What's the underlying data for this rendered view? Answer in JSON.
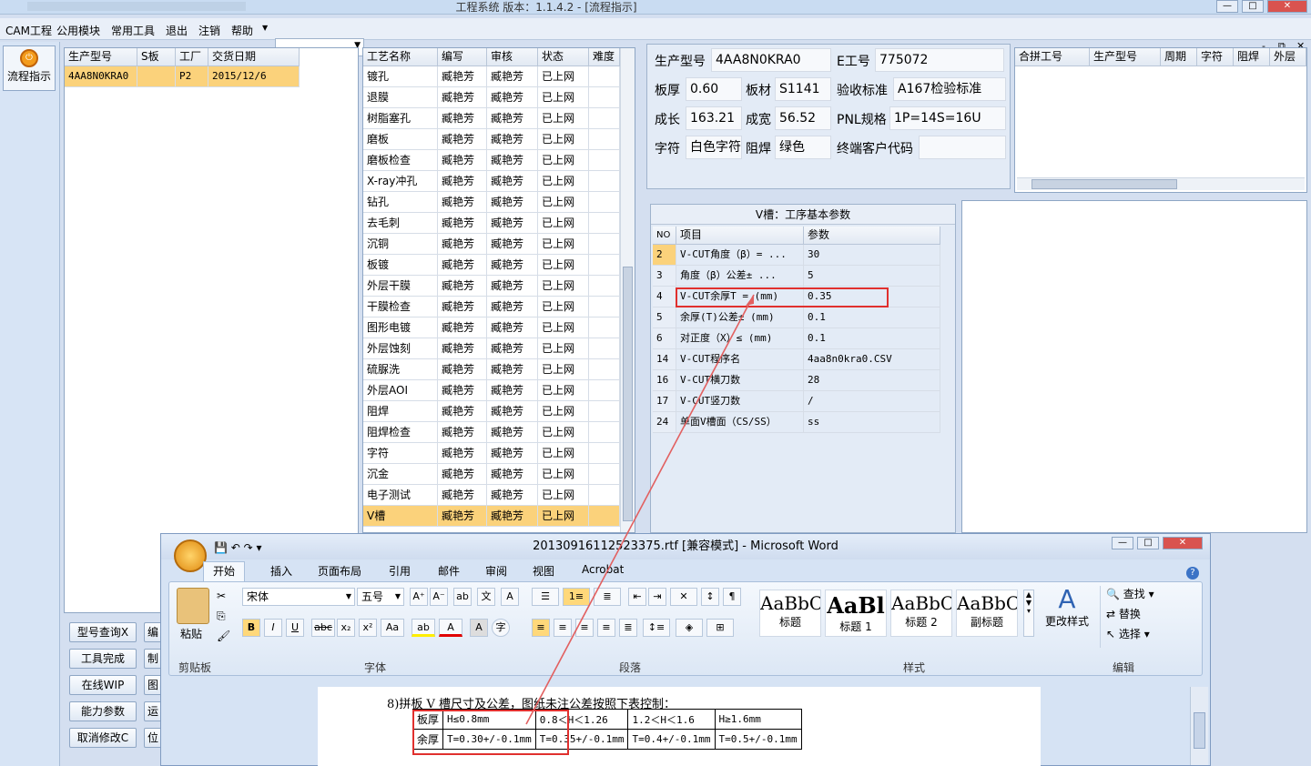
{
  "app": {
    "title": "工程系统   版本：1.1.4.2 - [流程指示]",
    "win_min": "—",
    "win_max": "□",
    "win_close": "✕"
  },
  "menu": [
    "CAM工程",
    "公用模块",
    "常用工具",
    "退出",
    "注销",
    "帮助"
  ],
  "mdi_controls": [
    "-",
    "⧉",
    "✕"
  ],
  "left_nav": {
    "flow_button": "流程指示"
  },
  "order_grid": {
    "headers": [
      "生产型号",
      "S板",
      "工厂",
      "交货日期"
    ],
    "rows": [
      [
        "4AA8N0KRA0",
        "",
        "P2",
        "2015/12/6"
      ]
    ]
  },
  "bottom_buttons": [
    "型号查询X",
    "工具完成",
    "在线WIP",
    "能力参数",
    "取消修改C"
  ],
  "bottom_buttons_right": [
    "编",
    "制",
    "图",
    "运",
    "位"
  ],
  "process_grid": {
    "headers": [
      "工艺名称",
      "编写",
      "审核",
      "状态",
      "难度"
    ],
    "rows": [
      [
        "镀孔",
        "臧艳芳",
        "臧艳芳",
        "已上网"
      ],
      [
        "退膜",
        "臧艳芳",
        "臧艳芳",
        "已上网"
      ],
      [
        "树脂塞孔",
        "臧艳芳",
        "臧艳芳",
        "已上网"
      ],
      [
        "磨板",
        "臧艳芳",
        "臧艳芳",
        "已上网"
      ],
      [
        "磨板检查",
        "臧艳芳",
        "臧艳芳",
        "已上网"
      ],
      [
        "X-ray冲孔",
        "臧艳芳",
        "臧艳芳",
        "已上网"
      ],
      [
        "钻孔",
        "臧艳芳",
        "臧艳芳",
        "已上网"
      ],
      [
        "去毛刺",
        "臧艳芳",
        "臧艳芳",
        "已上网"
      ],
      [
        "沉铜",
        "臧艳芳",
        "臧艳芳",
        "已上网"
      ],
      [
        "板镀",
        "臧艳芳",
        "臧艳芳",
        "已上网"
      ],
      [
        "外层干膜",
        "臧艳芳",
        "臧艳芳",
        "已上网"
      ],
      [
        "干膜检查",
        "臧艳芳",
        "臧艳芳",
        "已上网"
      ],
      [
        "图形电镀",
        "臧艳芳",
        "臧艳芳",
        "已上网"
      ],
      [
        "外层蚀刻",
        "臧艳芳",
        "臧艳芳",
        "已上网"
      ],
      [
        "硫脲洗",
        "臧艳芳",
        "臧艳芳",
        "已上网"
      ],
      [
        "外层AOI",
        "臧艳芳",
        "臧艳芳",
        "已上网"
      ],
      [
        "阻焊",
        "臧艳芳",
        "臧艳芳",
        "已上网"
      ],
      [
        "阻焊检查",
        "臧艳芳",
        "臧艳芳",
        "已上网"
      ],
      [
        "字符",
        "臧艳芳",
        "臧艳芳",
        "已上网"
      ],
      [
        "沉金",
        "臧艳芳",
        "臧艳芳",
        "已上网"
      ],
      [
        "电子测试",
        "臧艳芳",
        "臧艳芳",
        "已上网"
      ],
      [
        "V槽",
        "臧艳芳",
        "臧艳芳",
        "已上网"
      ]
    ]
  },
  "product_info": {
    "fields": [
      {
        "label": "生产型号",
        "value": "4AA8N0KRA0"
      },
      {
        "label": "E工号",
        "value": "775072"
      },
      {
        "label": "板厚",
        "value": "0.60"
      },
      {
        "label": "板材",
        "value": "S1141"
      },
      {
        "label": "验收标准",
        "value": "A167检验标准"
      },
      {
        "label": "成长",
        "value": "163.21"
      },
      {
        "label": "成宽",
        "value": "56.52"
      },
      {
        "label": "PNL规格",
        "value": "1P=14S=16U"
      },
      {
        "label": "字符",
        "value": "白色字符"
      },
      {
        "label": "阻焊",
        "value": "绿色"
      },
      {
        "label": "终端客户代码",
        "value": ""
      }
    ]
  },
  "merge_grid": {
    "headers": [
      "合拼工号",
      "生产型号",
      "周期",
      "字符",
      "阻焊",
      "外层"
    ]
  },
  "vcut": {
    "caption": "V槽：工序基本参数",
    "headers": [
      "NO",
      "项目",
      "参数"
    ],
    "rows": [
      [
        "2",
        "V-CUT角度（β）=  ...",
        "30"
      ],
      [
        "3",
        "角度（β）公差±  ...",
        "5"
      ],
      [
        "4",
        "V-CUT余厚T =  (mm)",
        "0.35"
      ],
      [
        "5",
        "余厚(T)公差±  (mm)",
        "0.1"
      ],
      [
        "6",
        "对正度（X）≤ (mm)",
        "0.1"
      ],
      [
        "14",
        "V-CUT程序名",
        "4aa8n0kra0.CSV"
      ],
      [
        "16",
        "V-CUT横刀数",
        "28"
      ],
      [
        "17",
        "V-CUT竖刀数",
        "/"
      ],
      [
        "24",
        "单面V槽面（CS/SS）",
        "ss"
      ]
    ]
  },
  "word": {
    "title": "20130916112523375.rtf [兼容模式] - Microsoft Word",
    "tabs": [
      "开始",
      "插入",
      "页面布局",
      "引用",
      "邮件",
      "审阅",
      "视图",
      "Acrobat"
    ],
    "font_name": "宋体",
    "font_size": "五号",
    "groups": [
      "剪贴板",
      "字体",
      "段落",
      "样式",
      "编辑"
    ],
    "paste_label": "粘贴",
    "styles": [
      {
        "preview": "AaBbC",
        "name": "标题"
      },
      {
        "preview": "AaBl",
        "name": "标题 1"
      },
      {
        "preview": "AaBbC",
        "name": "标题 2"
      },
      {
        "preview": "AaBbC",
        "name": "副标题"
      }
    ],
    "change_styles": "更改样式",
    "edit_items": [
      "查找",
      "替换",
      "选择"
    ],
    "doc_line": "8)拼板 V 槽尺寸及公差，图纸未注公差按照下表控制：",
    "doc_table": [
      [
        "板厚",
        "H≤0.8mm",
        "0.8＜H＜1.26",
        "1.2＜H＜1.6",
        "H≥1.6mm"
      ],
      [
        "余厚",
        "T=0.30+/-0.1mm",
        "T=0.35+/-0.1mm",
        "T=0.4+/-0.1mm",
        "T=0.5+/-0.1mm"
      ]
    ]
  },
  "colors": {
    "highlight": "#e0302e",
    "selected_row": "#fbd27b",
    "accent": "#f39b1c"
  }
}
